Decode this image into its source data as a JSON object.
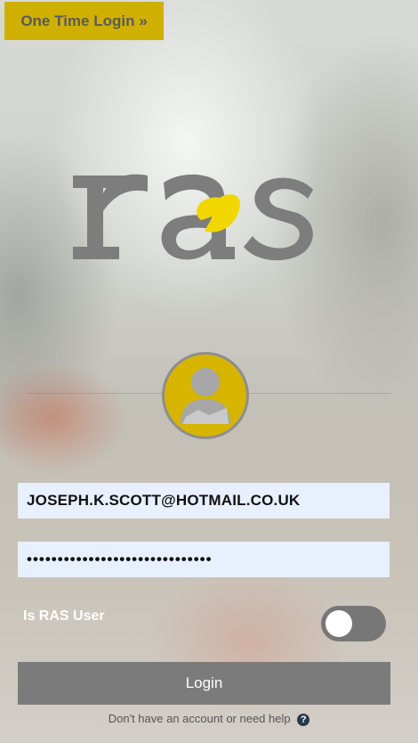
{
  "header": {
    "one_time_login_label": "One Time Login »"
  },
  "logo": {
    "text": "ras",
    "brand_gray": "#7d7d7d",
    "brand_yellow": "#f2d600"
  },
  "avatar": {
    "icon": "user-icon",
    "background": "#d6b400"
  },
  "form": {
    "email_value": "JOSEPH.K.SCOTT@HOTMAIL.CO.UK",
    "password_value": "••••••••••••••••••••••••••••••",
    "ras_user_label": "Is RAS User",
    "ras_user_toggle": false,
    "login_label": "Login"
  },
  "footer": {
    "help_text": "Don't have an account or need help",
    "help_icon": "question-circle-icon"
  }
}
